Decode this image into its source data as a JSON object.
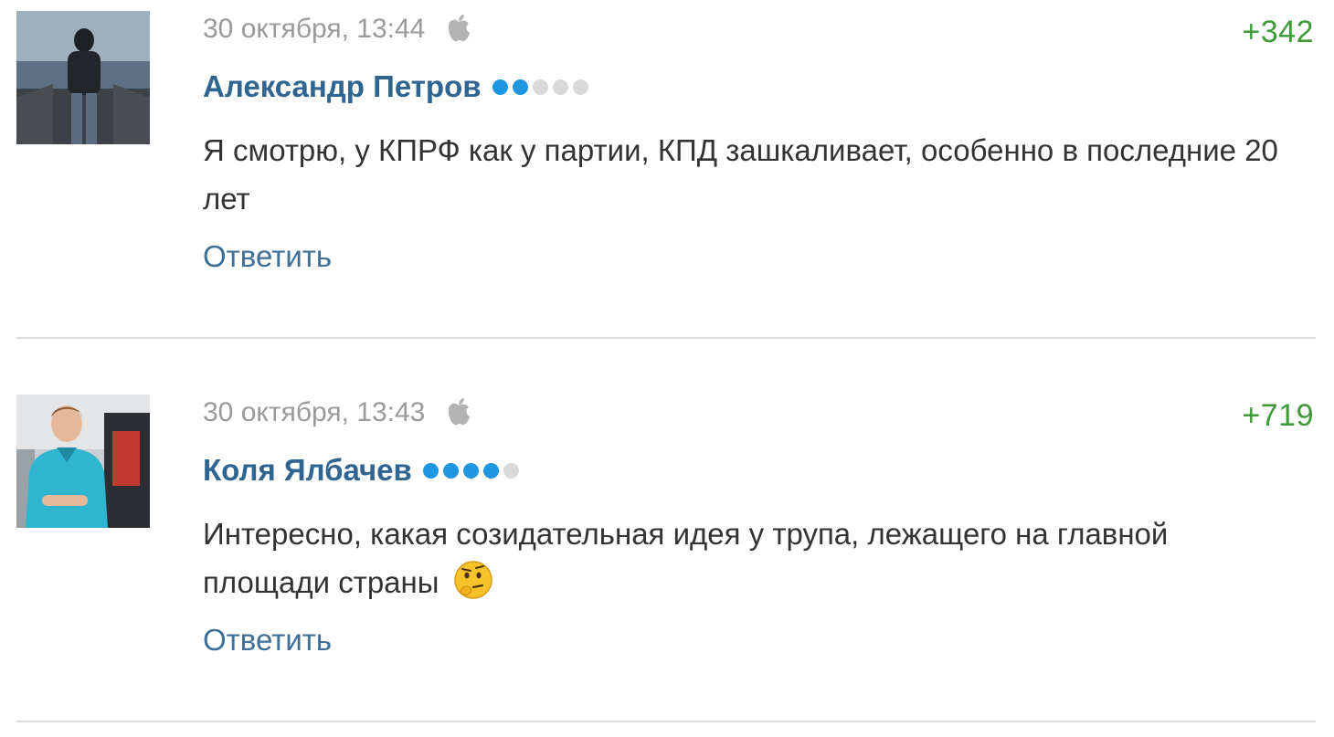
{
  "comments": [
    {
      "datetime": "30 октября, 13:44",
      "device_icon": "apple-icon",
      "score": "+342",
      "author": "Александр Петров",
      "rating_level": 2,
      "rating_max": 5,
      "text": "Я смотрю, у КПРФ как у партии, КПД зашкаливает, особенно в последние 20 лет",
      "reply_label": "Ответить"
    },
    {
      "datetime": "30 октября, 13:43",
      "device_icon": "apple-icon",
      "score": "+719",
      "author": "Коля Ялбачев",
      "rating_level": 4,
      "rating_max": 5,
      "text": "Интересно, какая созидательная идея у трупа, лежащего на главной площади страны",
      "emoji": "thinking-face-emoji",
      "reply_label": "Ответить"
    }
  ],
  "colors": {
    "author": "#2f6590",
    "score": "#3f9a3a",
    "meta": "#9a9a9a",
    "rating_on": "#1e96e1",
    "rating_off": "#d9d9d9"
  }
}
